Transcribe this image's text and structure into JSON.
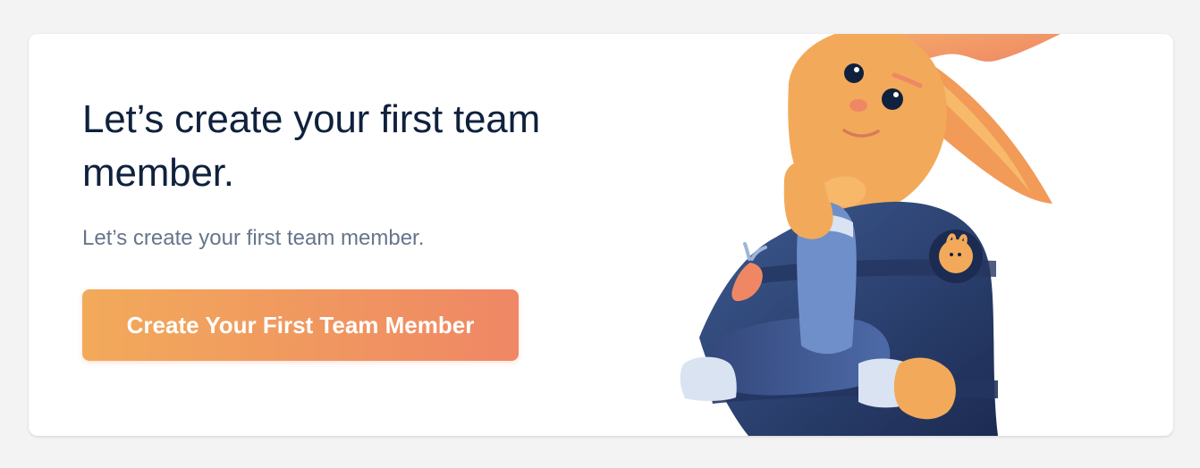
{
  "empty_state": {
    "title": "Let’s create your first team member.",
    "description": "Let’s create your first team member.",
    "cta_label": "Create Your First Team Member"
  },
  "illustration": {
    "name": "thinking-rabbit-mascot",
    "colors": {
      "fur": "#f2aa5a",
      "fur_dark": "#ef8765",
      "jacket": "#34497c",
      "jacket_dark": "#1c2b52",
      "stripe": "#d9e3f2"
    }
  }
}
